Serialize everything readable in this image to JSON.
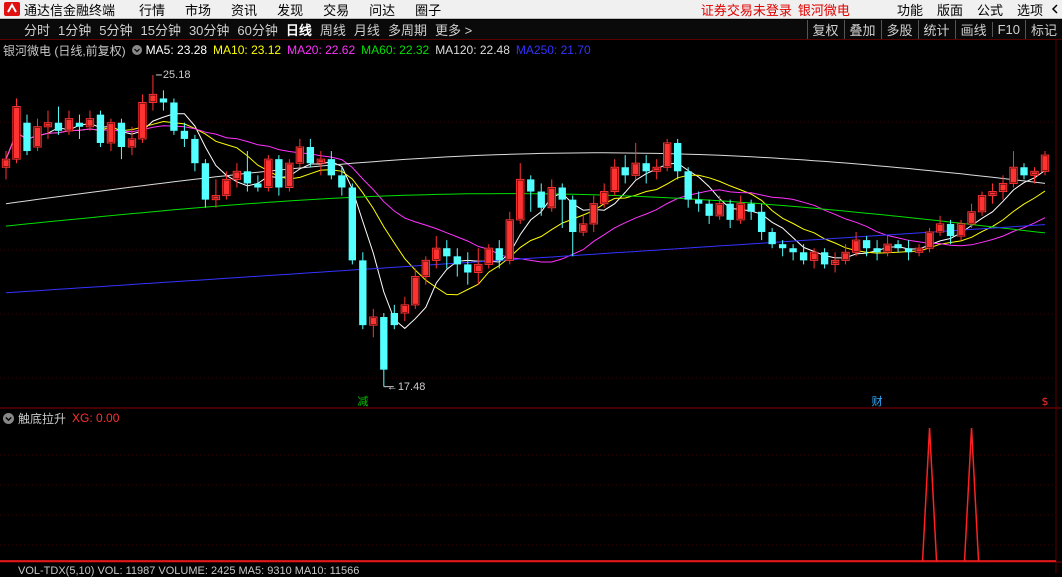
{
  "menubar": {
    "app_name": "通达信金融终端",
    "items": [
      "行情",
      "市场",
      "资讯",
      "发现",
      "交易",
      "问达",
      "圈子"
    ],
    "warning": "证券交易未登录",
    "stock_name": "银河微电",
    "right_items": [
      "功能",
      "版面",
      "公式",
      "选项"
    ]
  },
  "toolbar": {
    "periods": [
      "分时",
      "1分钟",
      "5分钟",
      "15分钟",
      "30分钟",
      "60分钟",
      "日线",
      "周线",
      "月线",
      "多周期",
      "更多 >"
    ],
    "active": "日线",
    "right_buttons": [
      "复权",
      "叠加",
      "多股",
      "统计",
      "画线",
      "F10",
      "标记"
    ]
  },
  "main_legend": {
    "title": "银河微电 (日线,前复权)",
    "ma": [
      {
        "label": "MA5: 23.28",
        "color": "#ffffff"
      },
      {
        "label": "MA10: 23.12",
        "color": "#ffff00"
      },
      {
        "label": "MA20: 22.62",
        "color": "#ff33ff"
      },
      {
        "label": "MA60: 22.32",
        "color": "#00e000"
      },
      {
        "label": "MA120: 22.48",
        "color": "#dcdcdc"
      },
      {
        "label": "MA250: 21.70",
        "color": "#3333ff"
      }
    ]
  },
  "annotations": {
    "high": "25.18",
    "low": "17.48",
    "markers": [
      {
        "label": "减",
        "color": "#00c000",
        "index": 34
      },
      {
        "label": "财",
        "color": "#33aaff",
        "index": 83
      },
      {
        "label": "$",
        "color": "#ff3030",
        "index": 140
      }
    ]
  },
  "sub_indicator": {
    "name": "触底拉升",
    "value": "XG: 0.00",
    "value_color": "#ff3030"
  },
  "bottom_legend": {
    "text": "VOL-TDX(5,10) VOL: 11987 VOLUME: 2425 MA5: 9310 MA10: 11566"
  },
  "chart_data": {
    "type": "candlestick",
    "high": 25.18,
    "low": 17.48,
    "up_color": "#ff3232",
    "down_color": "#54ffff",
    "candles": [
      [
        22.9,
        23.1,
        22.6,
        23.3
      ],
      [
        23.1,
        24.4,
        23.0,
        24.6
      ],
      [
        24.0,
        23.3,
        23.2,
        24.2
      ],
      [
        23.4,
        23.9,
        23.3,
        24.1
      ],
      [
        23.9,
        24.0,
        23.6,
        24.3
      ],
      [
        24.0,
        23.8,
        23.7,
        24.4
      ],
      [
        23.8,
        24.1,
        23.7,
        24.3
      ],
      [
        24.0,
        23.9,
        23.6,
        24.2
      ],
      [
        23.9,
        24.1,
        23.8,
        24.3
      ],
      [
        24.2,
        23.5,
        23.4,
        24.3
      ],
      [
        23.5,
        24.0,
        23.3,
        24.1
      ],
      [
        24.0,
        23.4,
        23.1,
        24.1
      ],
      [
        23.4,
        23.6,
        23.2,
        23.9
      ],
      [
        23.6,
        24.5,
        23.5,
        24.7
      ],
      [
        24.5,
        24.7,
        24.3,
        25.18
      ],
      [
        24.6,
        24.5,
        24.3,
        24.8
      ],
      [
        24.5,
        23.8,
        23.7,
        24.6
      ],
      [
        23.8,
        23.6,
        23.4,
        24.0
      ],
      [
        23.6,
        23.0,
        22.8,
        23.7
      ],
      [
        23.0,
        22.1,
        21.9,
        23.1
      ],
      [
        22.1,
        22.2,
        21.9,
        22.6
      ],
      [
        22.2,
        22.6,
        22.1,
        22.8
      ],
      [
        22.6,
        22.8,
        22.4,
        23.0
      ],
      [
        22.8,
        22.5,
        22.3,
        23.3
      ],
      [
        22.5,
        22.4,
        22.3,
        22.7
      ],
      [
        22.4,
        23.1,
        22.3,
        23.2
      ],
      [
        23.1,
        22.4,
        22.2,
        23.2
      ],
      [
        22.4,
        23.0,
        22.3,
        23.1
      ],
      [
        23.0,
        23.4,
        22.9,
        23.6
      ],
      [
        23.4,
        23.0,
        22.9,
        23.6
      ],
      [
        23.0,
        23.1,
        22.7,
        23.3
      ],
      [
        23.1,
        22.7,
        22.6,
        23.3
      ],
      [
        22.7,
        22.4,
        22.2,
        22.9
      ],
      [
        22.4,
        20.6,
        20.5,
        22.5
      ],
      [
        20.6,
        19.0,
        18.9,
        20.8
      ],
      [
        19.0,
        19.2,
        18.7,
        19.4
      ],
      [
        19.2,
        17.9,
        17.48,
        19.3
      ],
      [
        19.3,
        19.0,
        18.9,
        19.5
      ],
      [
        19.3,
        19.5,
        19.1,
        19.7
      ],
      [
        19.5,
        20.2,
        19.4,
        20.4
      ],
      [
        20.2,
        20.6,
        20.0,
        20.7
      ],
      [
        20.6,
        20.9,
        20.4,
        21.2
      ],
      [
        20.9,
        20.7,
        20.4,
        21.1
      ],
      [
        20.7,
        20.5,
        20.2,
        20.9
      ],
      [
        20.5,
        20.3,
        20.0,
        20.8
      ],
      [
        20.3,
        20.5,
        20.0,
        20.9
      ],
      [
        20.5,
        20.9,
        20.4,
        21.0
      ],
      [
        20.9,
        20.6,
        20.4,
        21.1
      ],
      [
        20.6,
        21.6,
        20.5,
        21.8
      ],
      [
        21.6,
        22.6,
        21.5,
        23.0
      ],
      [
        22.6,
        22.3,
        21.8,
        22.7
      ],
      [
        22.3,
        21.9,
        21.7,
        22.5
      ],
      [
        21.9,
        22.4,
        21.8,
        22.6
      ],
      [
        22.4,
        22.1,
        21.4,
        22.5
      ],
      [
        22.1,
        21.3,
        20.7,
        22.2
      ],
      [
        21.3,
        21.5,
        21.2,
        21.7
      ],
      [
        21.5,
        22.0,
        21.3,
        22.2
      ],
      [
        22.0,
        22.3,
        21.9,
        22.5
      ],
      [
        22.3,
        22.9,
        22.2,
        23.1
      ],
      [
        22.9,
        22.7,
        22.5,
        23.2
      ],
      [
        22.7,
        23.0,
        22.6,
        23.5
      ],
      [
        23.0,
        22.8,
        22.5,
        23.2
      ],
      [
        22.8,
        22.9,
        22.6,
        23.1
      ],
      [
        22.9,
        23.5,
        22.8,
        23.6
      ],
      [
        23.5,
        22.8,
        22.6,
        23.6
      ],
      [
        22.8,
        22.1,
        21.9,
        22.9
      ],
      [
        22.1,
        22.0,
        21.8,
        22.3
      ],
      [
        22.0,
        21.7,
        21.5,
        22.1
      ],
      [
        21.7,
        22.0,
        21.6,
        22.2
      ],
      [
        22.0,
        21.6,
        21.4,
        22.1
      ],
      [
        21.6,
        22.0,
        21.5,
        22.2
      ],
      [
        22.0,
        21.8,
        21.6,
        22.1
      ],
      [
        21.8,
        21.3,
        21.1,
        22.0
      ],
      [
        21.3,
        21.0,
        20.9,
        21.4
      ],
      [
        21.0,
        20.9,
        20.7,
        21.1
      ],
      [
        20.9,
        20.8,
        20.6,
        21.0
      ],
      [
        20.8,
        20.6,
        20.5,
        21.0
      ],
      [
        20.6,
        20.8,
        20.4,
        20.9
      ],
      [
        20.8,
        20.5,
        20.4,
        20.9
      ],
      [
        20.5,
        20.6,
        20.3,
        20.8
      ],
      [
        20.6,
        20.8,
        20.5,
        21.0
      ],
      [
        20.8,
        21.1,
        20.7,
        21.3
      ],
      [
        21.1,
        20.9,
        20.7,
        21.2
      ],
      [
        20.9,
        20.8,
        20.6,
        21.1
      ],
      [
        20.8,
        21.0,
        20.7,
        21.2
      ],
      [
        21.0,
        20.9,
        20.8,
        21.1
      ],
      [
        20.9,
        20.8,
        20.6,
        21.1
      ],
      [
        20.8,
        20.9,
        20.7,
        21.0
      ],
      [
        20.9,
        21.3,
        20.8,
        21.4
      ],
      [
        21.3,
        21.5,
        21.2,
        21.7
      ],
      [
        21.5,
        21.2,
        21.0,
        21.6
      ],
      [
        21.2,
        21.5,
        21.1,
        21.6
      ],
      [
        21.5,
        21.8,
        21.4,
        22.0
      ],
      [
        21.8,
        22.2,
        21.7,
        22.3
      ],
      [
        22.2,
        22.3,
        22.0,
        22.5
      ],
      [
        22.3,
        22.5,
        22.1,
        22.7
      ],
      [
        22.5,
        22.9,
        22.4,
        23.3
      ],
      [
        22.9,
        22.7,
        22.6,
        23.0
      ],
      [
        22.7,
        22.8,
        22.5,
        22.9
      ],
      [
        22.8,
        23.2,
        22.7,
        23.3
      ]
    ],
    "sub_spikes": [
      {
        "index": 88,
        "value": 1
      },
      {
        "index": 92,
        "value": 1
      }
    ]
  }
}
